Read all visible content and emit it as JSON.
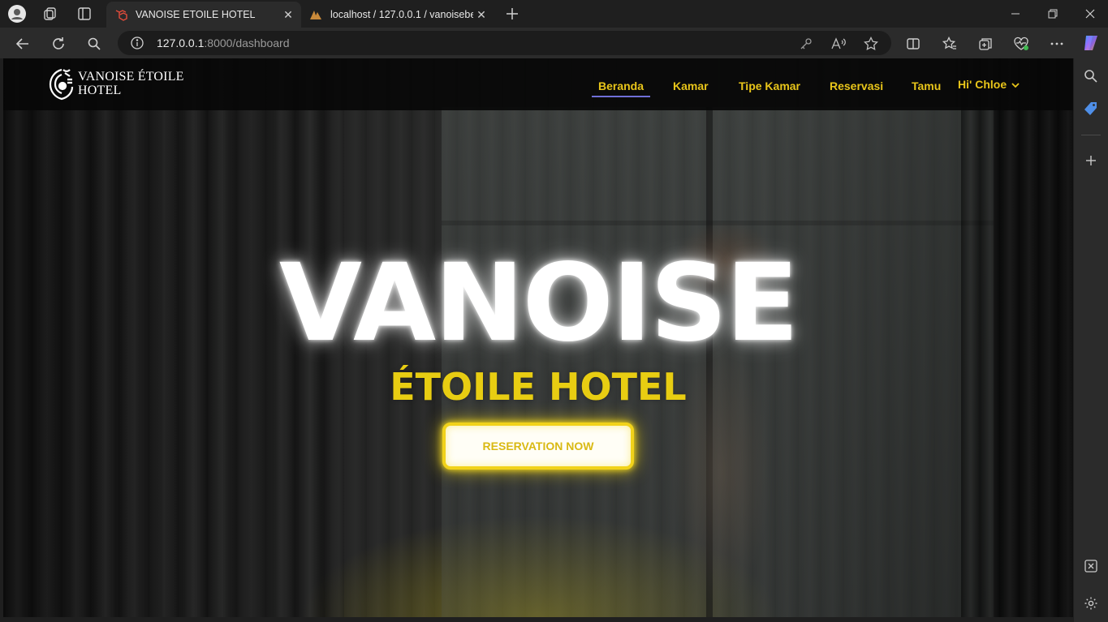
{
  "browser": {
    "tabs": [
      {
        "title": "VANOISE ETOILE HOTEL",
        "active": true
      },
      {
        "title": "localhost / 127.0.0.1 / vanoisebea",
        "active": false
      }
    ],
    "url_host": "127.0.0.1",
    "url_rest": ":8000/dashboard"
  },
  "site": {
    "logo_line1": "VANOISE ÉTOILE",
    "logo_line2": "HOTEL",
    "nav": [
      {
        "label": "Beranda",
        "active": true
      },
      {
        "label": "Kamar"
      },
      {
        "label": "Tipe Kamar"
      },
      {
        "label": "Reservasi"
      },
      {
        "label": "Tamu"
      }
    ],
    "user_greeting": "Hi' Chloe",
    "hero_title": "VANOISE",
    "hero_subtitle": "ÉTOILE HOTEL",
    "cta_label": "RESERVATION NOW"
  },
  "colors": {
    "accent": "#e8c51a",
    "nav_background": "#080808",
    "active_underline": "#6f6fd8"
  }
}
